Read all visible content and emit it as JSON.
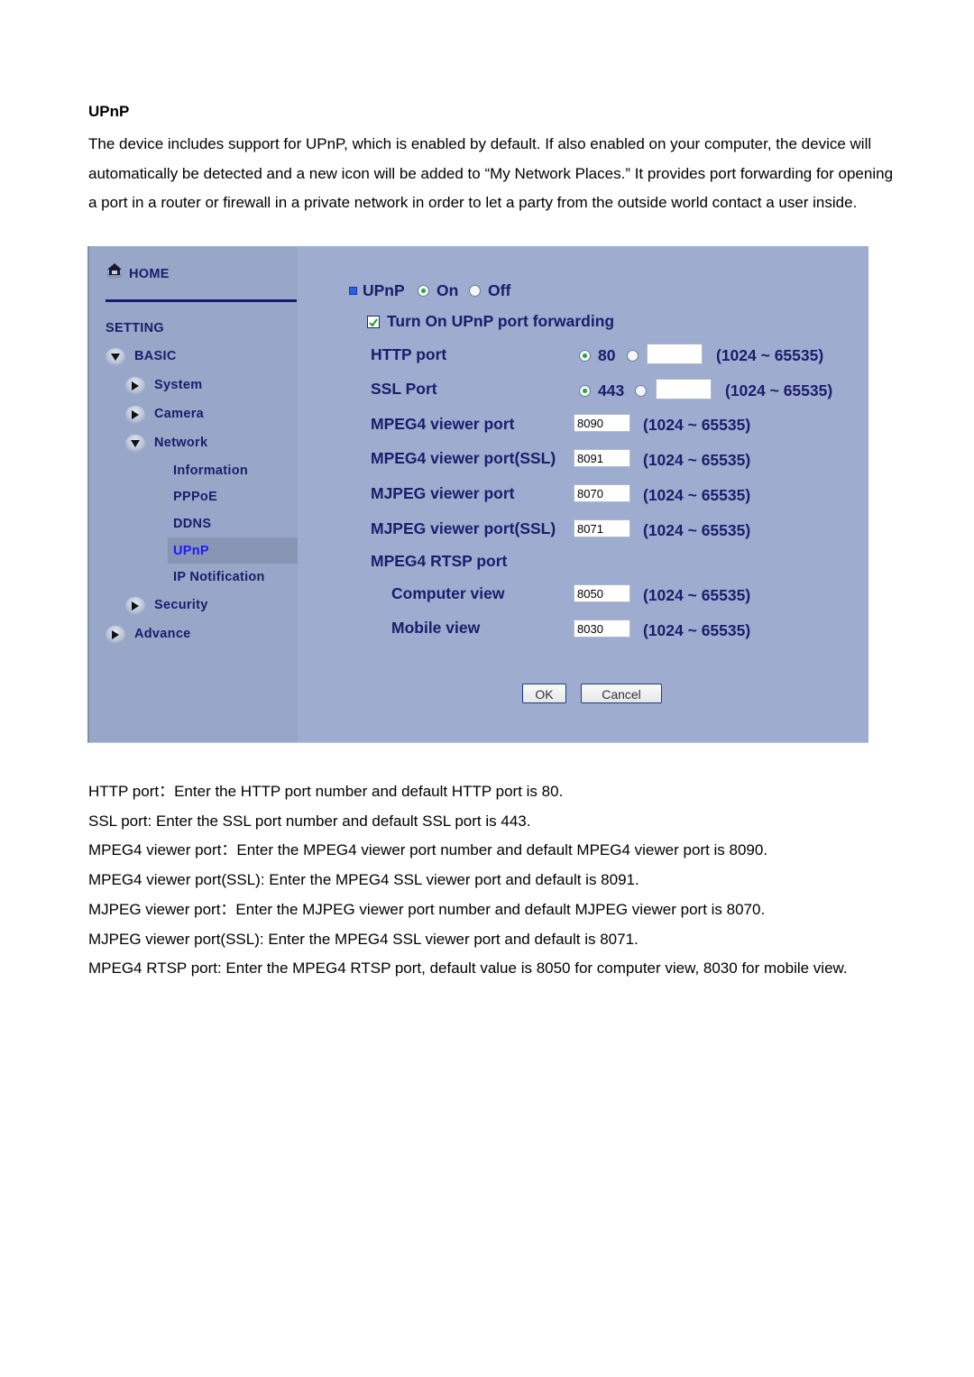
{
  "doc": {
    "heading": "UPnP",
    "intro": "The device includes support for UPnP, which is enabled by default. If also enabled on your computer, the device will automatically be detected and a new icon will be added to “My Network Places.” It provides port forwarding for opening a port in a router or firewall in a private network in order to let a party from the outside world contact a user inside.",
    "descriptions": [
      "HTTP port：Enter the HTTP port number and default HTTP port is 80.",
      "SSL port: Enter the SSL port number and default SSL port is 443.",
      "MPEG4 viewer port：Enter the MPEG4 viewer port number and default MPEG4 viewer port is 8090.",
      "MPEG4 viewer port(SSL): Enter the MPEG4 SSL viewer port and default is 8091.",
      "MJPEG viewer port：Enter the MJPEG viewer port number and default MJPEG viewer port is 8070.",
      "MJPEG viewer port(SSL): Enter the MPEG4 SSL viewer port and default is 8071.",
      "MPEG4 RTSP port: Enter the MPEG4 RTSP port, default value is 8050 for computer view, 8030 for mobile view."
    ]
  },
  "sidebar": {
    "home": "HOME",
    "setting": "SETTING",
    "basic": "BASIC",
    "system": "System",
    "camera": "Camera",
    "network": "Network",
    "information": "Information",
    "pppoe": "PPPoE",
    "ddns": "DDNS",
    "upnp": "UPnP",
    "ip_notification": "IP Notification",
    "security": "Security",
    "advance": "Advance"
  },
  "form": {
    "upnp_label": "UPnP",
    "on_label": "On",
    "off_label": "Off",
    "upnp_state": "On",
    "forwarding_label": "Turn On UPnP port forwarding",
    "forwarding_checked": true,
    "range": "(1024 ~ 65535)",
    "http": {
      "label": "HTTP port",
      "default": "80",
      "custom_value": ""
    },
    "ssl": {
      "label": "SSL Port",
      "default": "443",
      "custom_value": ""
    },
    "mpeg4_viewer": {
      "label": "MPEG4 viewer port",
      "value": "8090"
    },
    "mpeg4_viewer_ssl": {
      "label": "MPEG4 viewer port(SSL)",
      "value": "8091"
    },
    "mjpeg_viewer": {
      "label": "MJPEG viewer port",
      "value": "8070"
    },
    "mjpeg_viewer_ssl": {
      "label": "MJPEG viewer port(SSL)",
      "value": "8071"
    },
    "rtsp_label": "MPEG4 RTSP port",
    "computer_view": {
      "label": "Computer view",
      "value": "8050"
    },
    "mobile_view": {
      "label": "Mobile view",
      "value": "8030"
    },
    "ok_label": "OK",
    "cancel_label": "Cancel"
  },
  "colors": {
    "panel_bg": "#9eaccf",
    "nav_text": "#1c1c6c",
    "nav_active": "#1b1bff"
  }
}
